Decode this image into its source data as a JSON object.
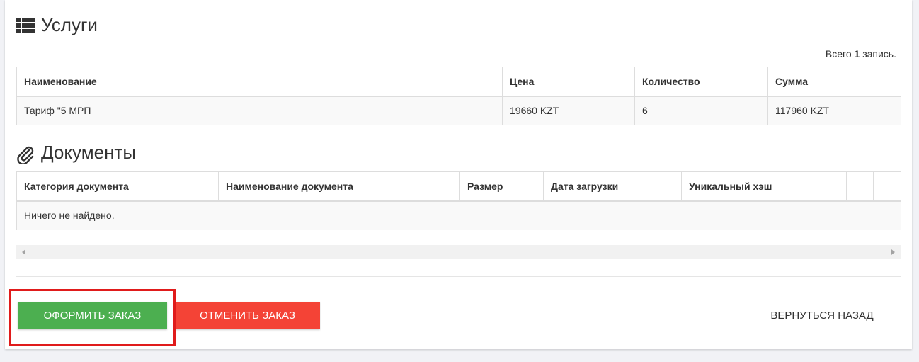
{
  "services": {
    "title": "Услуги",
    "icon": "list-icon",
    "summary_prefix": "Всего ",
    "summary_count": "1",
    "summary_suffix": " запись.",
    "columns": [
      "Наименование",
      "Цена",
      "Количество",
      "Сумма"
    ],
    "rows": [
      [
        "Тариф \"5 МРП",
        "19660 KZT",
        "6",
        "117960 KZT"
      ]
    ]
  },
  "documents": {
    "title": "Документы",
    "icon": "paperclip-icon",
    "columns": [
      "Категория документа",
      "Наименование документа",
      "Размер",
      "Дата загрузки",
      "Уникальный хэш",
      "",
      ""
    ],
    "empty_text": "Ничего не найдено."
  },
  "actions": {
    "submit_label": "ОФОРМИТЬ ЗАКАЗ",
    "cancel_label": "ОТМЕНИТЬ ЗАКАЗ",
    "back_label": "ВЕРНУТЬСЯ НАЗАД"
  },
  "colors": {
    "submit": "#4caf50",
    "cancel": "#f44336",
    "highlight": "#e01b1b"
  }
}
